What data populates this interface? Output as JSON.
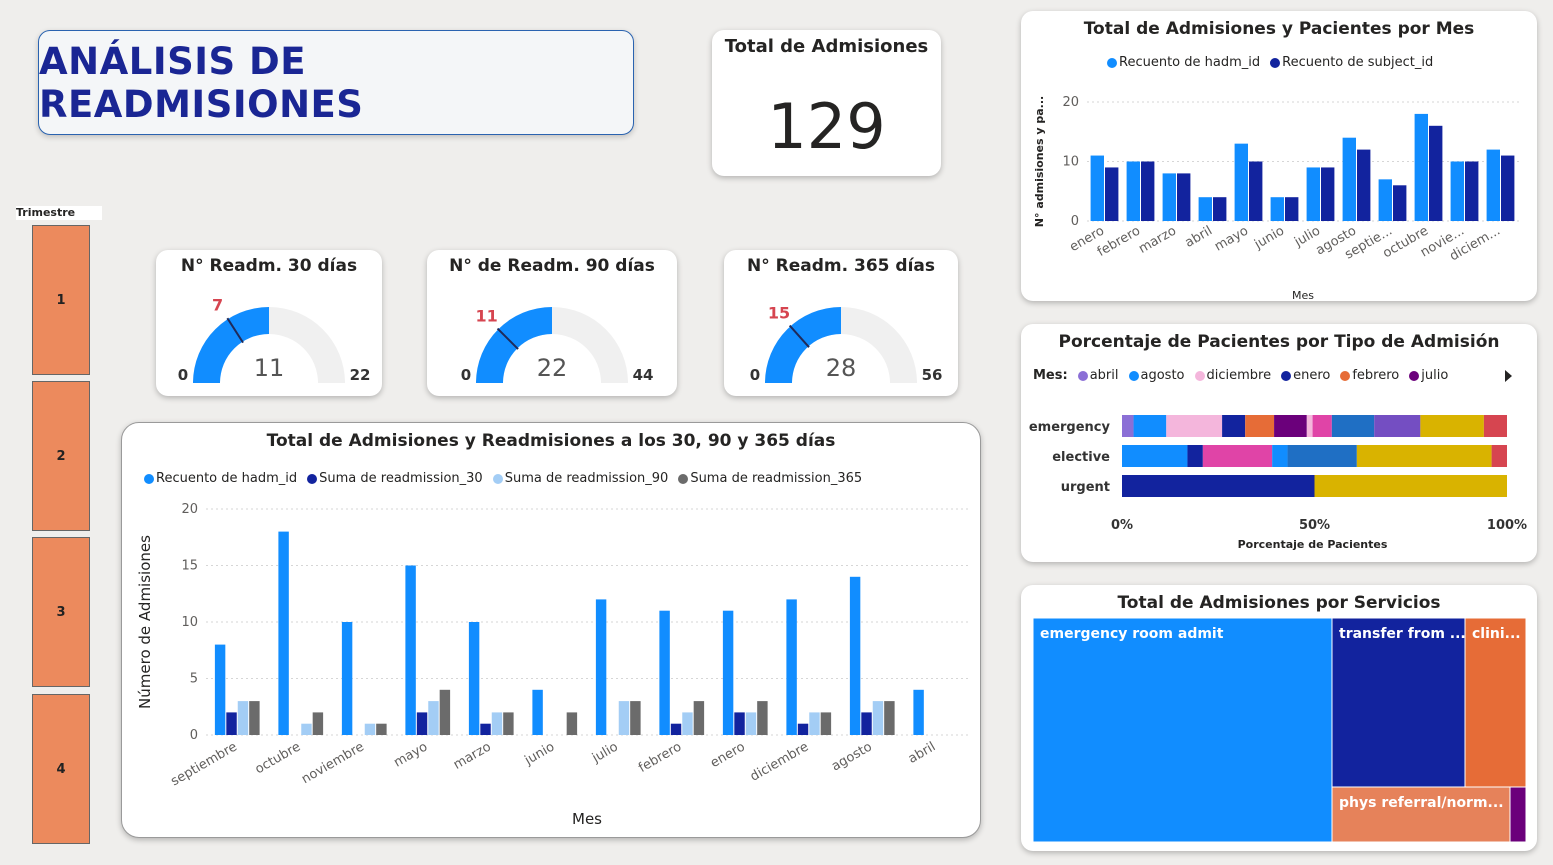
{
  "page_title": "ANÁLISIS DE READMISIONES",
  "kpi": {
    "label": "Total de Admisiones",
    "value": "129"
  },
  "slicer": {
    "title": "Trimestre",
    "items": [
      "1",
      "2",
      "3",
      "4"
    ]
  },
  "colors": {
    "hadm": "#118dff",
    "subject": "#12239e",
    "r30": "#12239e",
    "r90": "#a3cdf5",
    "r365": "#6b6b6b",
    "gauge_fill": "#118dff",
    "gauge_bg": "#f0f0f0",
    "target": "#d64550",
    "slicer": "#ec8a5d"
  },
  "gauges": [
    {
      "title": "N° Readm. 30 días",
      "min": "0",
      "max": "22",
      "value": "11",
      "target": "7",
      "value_num": 11,
      "max_num": 22,
      "target_num": 7
    },
    {
      "title": "N° de Readm. 90 días",
      "min": "0",
      "max": "44",
      "value": "22",
      "target": "11",
      "value_num": 22,
      "max_num": 44,
      "target_num": 11
    },
    {
      "title": "N° Readm. 365 días",
      "min": "0",
      "max": "56",
      "value": "28",
      "target": "15",
      "value_num": 28,
      "max_num": 56,
      "target_num": 15
    }
  ],
  "chart_data": [
    {
      "type": "bar",
      "title": "Total de Admisiones y Readmisiones a los 30, 90 y 365 días",
      "xlabel": "Mes",
      "ylabel": "Número de Admisiones",
      "ylim": [
        0,
        20
      ],
      "yticks": [
        0,
        5,
        10,
        15,
        20
      ],
      "categories": [
        "septiembre",
        "octubre",
        "noviembre",
        "mayo",
        "marzo",
        "junio",
        "julio",
        "febrero",
        "enero",
        "diciembre",
        "agosto",
        "abril"
      ],
      "series": [
        {
          "name": "Recuento de hadm_id",
          "color": "#118dff",
          "values": [
            8,
            18,
            10,
            15,
            10,
            4,
            12,
            11,
            11,
            12,
            14,
            4
          ]
        },
        {
          "name": "Suma de readmission_30",
          "color": "#12239e",
          "values": [
            2,
            0,
            0,
            2,
            1,
            0,
            0,
            1,
            2,
            1,
            2,
            0
          ]
        },
        {
          "name": "Suma de readmission_90",
          "color": "#a3cdf5",
          "values": [
            3,
            1,
            1,
            3,
            2,
            0,
            3,
            2,
            2,
            2,
            3,
            0
          ]
        },
        {
          "name": "Suma de readmission_365",
          "color": "#6b6b6b",
          "values": [
            3,
            2,
            1,
            4,
            2,
            2,
            3,
            3,
            3,
            2,
            3,
            0
          ]
        }
      ],
      "grid": true,
      "legend": "top"
    },
    {
      "type": "bar",
      "title": "Total de Admisiones y Pacientes por Mes",
      "xlabel": "Mes",
      "ylabel": "N° admisiones y pa...",
      "ylim": [
        0,
        20
      ],
      "yticks": [
        0,
        10,
        20
      ],
      "categories": [
        "enero",
        "febrero",
        "marzo",
        "abril",
        "mayo",
        "junio",
        "julio",
        "agosto",
        "septie...",
        "octubre",
        "novie...",
        "diciem..."
      ],
      "series": [
        {
          "name": "Recuento de hadm_id",
          "color": "#118dff",
          "values": [
            11,
            10,
            8,
            4,
            13,
            4,
            9,
            14,
            7,
            18,
            10,
            12
          ]
        },
        {
          "name": "Recuento de subject_id",
          "color": "#12239e",
          "values": [
            9,
            10,
            8,
            4,
            10,
            4,
            9,
            12,
            6,
            16,
            10,
            11
          ]
        }
      ],
      "grid": true,
      "legend": "top"
    },
    {
      "type": "bar",
      "orientation": "horizontal-stacked-100",
      "title": "Porcentaje de Pacientes por Tipo de Admisión",
      "xlabel": "Porcentaje de Pacientes",
      "legend_title": "Mes:",
      "legend_items": [
        {
          "name": "abril",
          "color": "#8b6fd6"
        },
        {
          "name": "agosto",
          "color": "#118dff"
        },
        {
          "name": "diciembre",
          "color": "#f4b6dc"
        },
        {
          "name": "enero",
          "color": "#12239e"
        },
        {
          "name": "febrero",
          "color": "#e66c37"
        },
        {
          "name": "julio",
          "color": "#6b007b"
        }
      ],
      "xticks": [
        "0%",
        "50%",
        "100%"
      ],
      "categories": [
        "emergency",
        "elective",
        "urgent"
      ],
      "rows": [
        {
          "label": "emergency",
          "segments": [
            {
              "pct": 3,
              "color": "#8b6fd6"
            },
            {
              "pct": 8.5,
              "color": "#118dff"
            },
            {
              "pct": 14.5,
              "color": "#f4b6dc"
            },
            {
              "pct": 6,
              "color": "#12239e"
            },
            {
              "pct": 7.5,
              "color": "#e66c37"
            },
            {
              "pct": 8.5,
              "color": "#6b007b"
            },
            {
              "pct": 1.5,
              "color": "#f4b6dc"
            },
            {
              "pct": 5,
              "color": "#e044a7"
            },
            {
              "pct": 11,
              "color": "#1f6fc4"
            },
            {
              "pct": 12,
              "color": "#744ec2"
            },
            {
              "pct": 16.5,
              "color": "#d9b300"
            },
            {
              "pct": 6,
              "color": "#d64550"
            }
          ]
        },
        {
          "label": "elective",
          "segments": [
            {
              "pct": 17,
              "color": "#118dff"
            },
            {
              "pct": 4,
              "color": "#12239e"
            },
            {
              "pct": 18,
              "color": "#e044a7"
            },
            {
              "pct": 4,
              "color": "#118dff"
            },
            {
              "pct": 18,
              "color": "#1f6fc4"
            },
            {
              "pct": 35,
              "color": "#d9b300"
            },
            {
              "pct": 4,
              "color": "#d64550"
            }
          ]
        },
        {
          "label": "urgent",
          "segments": [
            {
              "pct": 50,
              "color": "#12239e"
            },
            {
              "pct": 50,
              "color": "#d9b300"
            }
          ]
        }
      ]
    },
    {
      "type": "treemap",
      "title": "Total de Admisiones por Servicios",
      "items": [
        {
          "label": "emergency room admit",
          "color": "#118dff"
        },
        {
          "label": "transfer from ...",
          "color": "#12239e"
        },
        {
          "label": "clini...",
          "color": "#e66c37"
        },
        {
          "label": "phys referral/norm...",
          "color": "#e6825a"
        },
        {
          "label": "",
          "color": "#6b007b"
        }
      ]
    }
  ]
}
